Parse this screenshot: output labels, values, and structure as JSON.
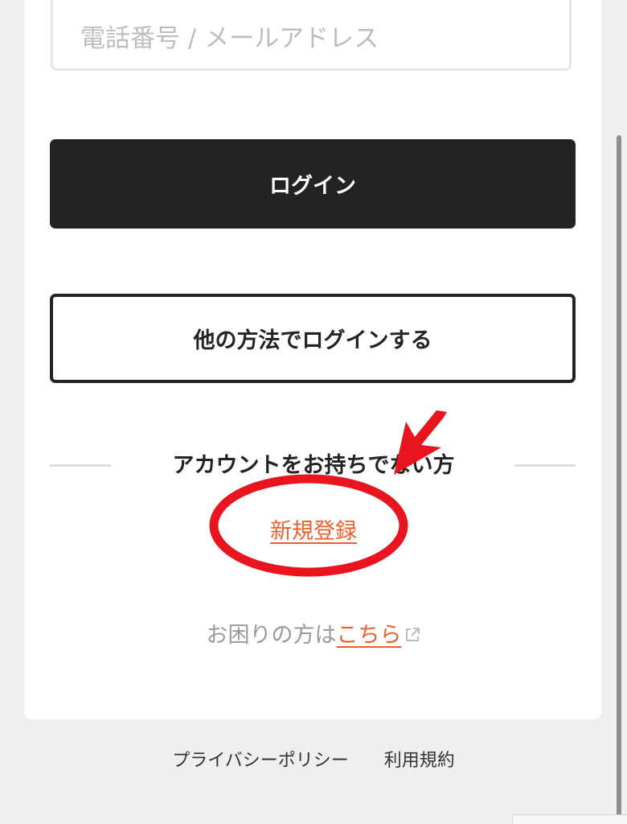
{
  "login_form": {
    "id_placeholder": "電話番号 / メールアドレス",
    "login_label": "ログイン",
    "other_login_label": "他の方法でログインする"
  },
  "signup": {
    "prompt": "アカウントをお持ちでない方",
    "register_label": "新規登録"
  },
  "help": {
    "prefix": "お困りの方は",
    "link_label": "こちら",
    "link_icon": "external-link-icon"
  },
  "footer": {
    "privacy": "プライバシーポリシー",
    "terms": "利用規約"
  },
  "colors": {
    "accent": "#e8622d",
    "primary_button": "#232323",
    "annotation": "#e8141e"
  }
}
